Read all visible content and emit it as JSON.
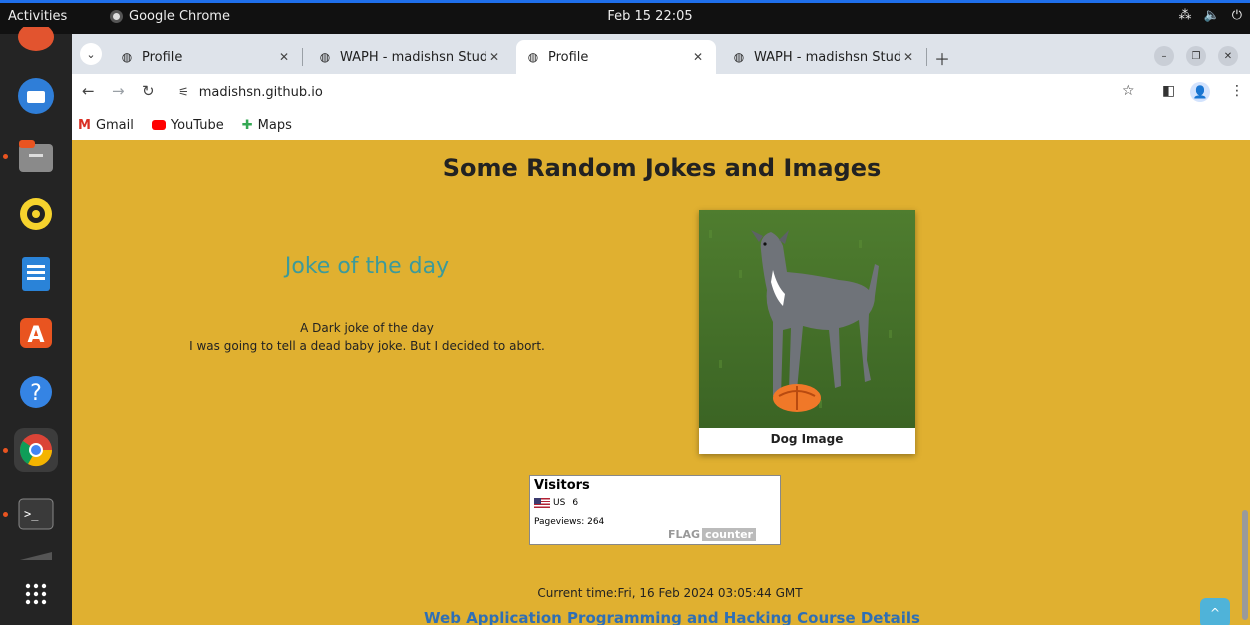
{
  "system": {
    "activities": "Activities",
    "app_name": "Google Chrome",
    "clock": "Feb 15 22:05"
  },
  "tabs": [
    {
      "title": "Profile",
      "active": false
    },
    {
      "title": "WAPH - madishsn Stude",
      "active": false
    },
    {
      "title": "Profile",
      "active": true
    },
    {
      "title": "WAPH - madishsn Stude",
      "active": false
    }
  ],
  "address_bar": {
    "url": "madishsn.github.io"
  },
  "bookmarks": [
    {
      "label": "Gmail",
      "icon": "gmail-icon"
    },
    {
      "label": "YouTube",
      "icon": "youtube-icon"
    },
    {
      "label": "Maps",
      "icon": "maps-icon"
    }
  ],
  "page": {
    "title": "Some Random Jokes and Images",
    "joke_heading": "Joke of the day",
    "joke_lines": [
      "A Dark joke of the day",
      "I was going to tell a dead baby joke. But I decided to abort."
    ],
    "dog_caption": "Dog Image",
    "visitors": {
      "title": "Visitors",
      "country": "US",
      "count": "6",
      "pageviews": "Pageviews:  264",
      "brand_flag": "FLAG",
      "brand_counter": "counter"
    },
    "current_time": "Current time:Fri, 16 Feb 2024 03:05:44 GMT",
    "course_link": "Web Application Programming and Hacking Course Details"
  },
  "colors": {
    "page_bg": "#e0b030",
    "joke_heading": "#3c9a9a",
    "link": "#2f6fb5"
  }
}
